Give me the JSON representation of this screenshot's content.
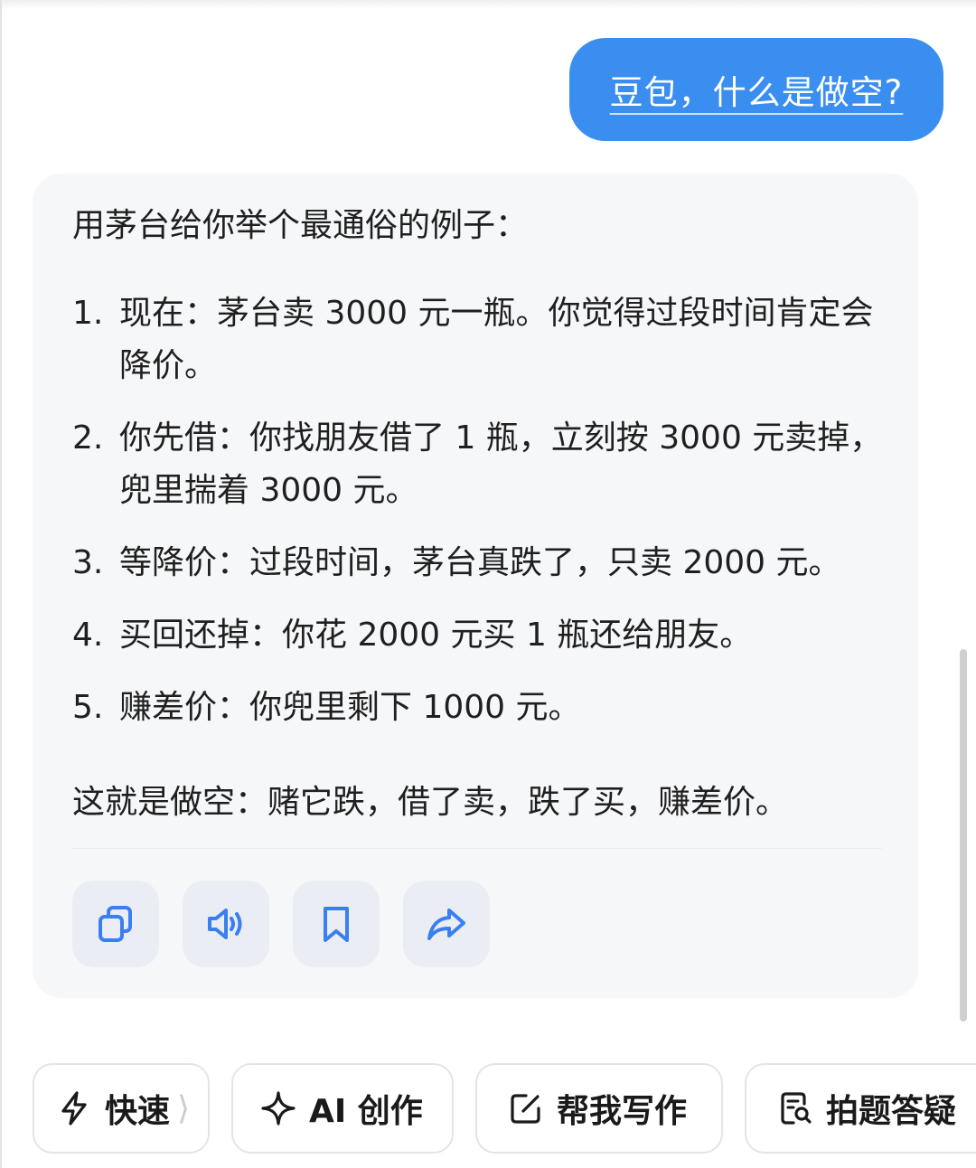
{
  "user_message": "豆包，什么是做空?",
  "assistant": {
    "intro": "用茅台给你举个最通俗的例子：",
    "steps": [
      {
        "num": "1.",
        "text": "现在：茅台卖 3000 元一瓶。你觉得过段时间肯定会降价。"
      },
      {
        "num": "2.",
        "text": "你先借：你找朋友借了 1 瓶，立刻按 3000 元卖掉，兜里揣着 3000 元。"
      },
      {
        "num": "3.",
        "text": "等降价：过段时间，茅台真跌了，只卖 2000 元。"
      },
      {
        "num": "4.",
        "text": "买回还掉：你花 2000 元买 1 瓶还给朋友。"
      },
      {
        "num": "5.",
        "text": "赚差价：你兜里剩下 1000 元。"
      }
    ],
    "summary": "这就是做空：赌它跌，借了卖，跌了买，赚差价。",
    "actions": [
      {
        "name": "copy",
        "icon": "copy-icon"
      },
      {
        "name": "speaker",
        "icon": "speaker-icon"
      },
      {
        "name": "bookmark",
        "icon": "bookmark-icon"
      },
      {
        "name": "share",
        "icon": "share-icon"
      }
    ]
  },
  "chips": {
    "fast": {
      "label": "快速",
      "icon": "lightning-icon",
      "suffix": "⟩"
    },
    "ai_create": {
      "label": "AI 创作",
      "icon": "sparkle-icon"
    },
    "help_write": {
      "label": "帮我写作",
      "icon": "edit-icon"
    },
    "photo_qa": {
      "label": "拍题答疑",
      "icon": "photo-search-icon"
    }
  },
  "colors": {
    "user_bubble": "#3a8ef0",
    "card_bg": "#f6f7f9",
    "accent_icon": "#3a7ff0",
    "action_bg": "#eaedf3"
  }
}
